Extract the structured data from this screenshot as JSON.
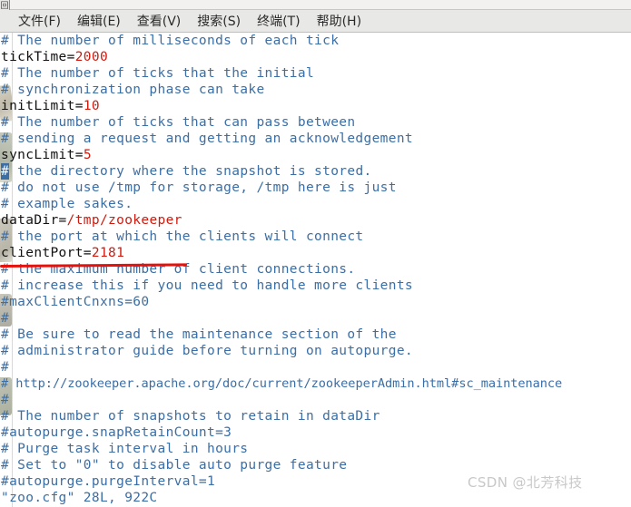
{
  "window": {
    "corner_glyph": "回"
  },
  "menubar": {
    "items": [
      {
        "label": "文件(F)",
        "name": "menu-file"
      },
      {
        "label": "编辑(E)",
        "name": "menu-edit"
      },
      {
        "label": "查看(V)",
        "name": "menu-view"
      },
      {
        "label": "搜索(S)",
        "name": "menu-search"
      },
      {
        "label": "终端(T)",
        "name": "menu-terminal"
      },
      {
        "label": "帮助(H)",
        "name": "menu-help"
      }
    ]
  },
  "editor": {
    "file_name": "zoo.cfg",
    "status_line": "\"zoo.cfg\" 28L, 922C",
    "cursor": {
      "line_index": 9,
      "column": 1,
      "char": "#"
    },
    "colors": {
      "comment": "#3b6ea5",
      "key": "#111111",
      "value": "#d01a0e",
      "cursor_bg": "#3a6ea5",
      "annotation_red": "#e8100a"
    },
    "lines": [
      {
        "type": "comment",
        "text": "# The number of milliseconds of each tick"
      },
      {
        "type": "setting",
        "key": "tickTime=",
        "value": "2000"
      },
      {
        "type": "comment",
        "text": "# The number of ticks that the initial"
      },
      {
        "type": "comment",
        "text": "# synchronization phase can take"
      },
      {
        "type": "setting",
        "key": "initLimit=",
        "value": "10"
      },
      {
        "type": "comment",
        "text": "# The number of ticks that can pass between"
      },
      {
        "type": "comment",
        "text": "# sending a request and getting an acknowledgement"
      },
      {
        "type": "setting",
        "key": "syncLimit=",
        "value": "5"
      },
      {
        "type": "comment-cursor",
        "cursor_char": "#",
        "text": " the directory where the snapshot is stored."
      },
      {
        "type": "comment",
        "text": "# do not use /tmp for storage, /tmp here is just"
      },
      {
        "type": "comment",
        "text": "# example sakes."
      },
      {
        "type": "setting",
        "key": "dataDir=",
        "value": "/tmp/zookeeper",
        "annotated": true
      },
      {
        "type": "comment",
        "text": "# the port at which the clients will connect"
      },
      {
        "type": "setting",
        "key": "clientPort=",
        "value": "2181"
      },
      {
        "type": "comment",
        "text": "# the maximum number of client connections."
      },
      {
        "type": "comment",
        "text": "# increase this if you need to handle more clients"
      },
      {
        "type": "comment",
        "text": "#maxClientCnxns=60"
      },
      {
        "type": "comment",
        "text": "#"
      },
      {
        "type": "comment",
        "text": "# Be sure to read the maintenance section of the"
      },
      {
        "type": "comment",
        "text": "# administrator guide before turning on autopurge."
      },
      {
        "type": "comment",
        "text": "#"
      },
      {
        "type": "comment",
        "narrow": true,
        "text": "# http://zookeeper.apache.org/doc/current/zookeeperAdmin.html#sc_maintenance"
      },
      {
        "type": "comment",
        "text": "#"
      },
      {
        "type": "comment",
        "text": "# The number of snapshots to retain in dataDir"
      },
      {
        "type": "comment",
        "text": "#autopurge.snapRetainCount=3"
      },
      {
        "type": "comment",
        "text": "# Purge task interval in hours"
      },
      {
        "type": "comment",
        "text": "# Set to \"0\" to disable auto purge feature"
      },
      {
        "type": "comment",
        "text": "#autopurge.purgeInterval=1"
      }
    ]
  },
  "watermark": {
    "text": "CSDN @北芳科技"
  }
}
